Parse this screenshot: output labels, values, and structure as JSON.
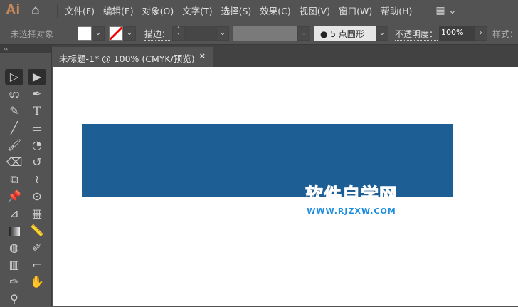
{
  "app": {
    "logo": "Ai"
  },
  "menu": [
    "文件(F)",
    "编辑(E)",
    "对象(O)",
    "文字(T)",
    "选择(S)",
    "效果(C)",
    "视图(V)",
    "窗口(W)",
    "帮助(H)"
  ],
  "control": {
    "selection": "未选择对象",
    "stroke_label": "描边：",
    "brush": "5 点圆形",
    "opacity_label": "不透明度：",
    "opacity_value": "100%",
    "style_label": "样式："
  },
  "tab": {
    "title": "未标题-1* @ 100% (CMYK/预览)",
    "close": "×"
  },
  "toolbar": {
    "collapse": "‹‹"
  },
  "artwork": {
    "rect_color": "#1d5e94"
  },
  "watermark": {
    "title": "软件自学网",
    "url": "WWW.RJZXW.COM"
  }
}
